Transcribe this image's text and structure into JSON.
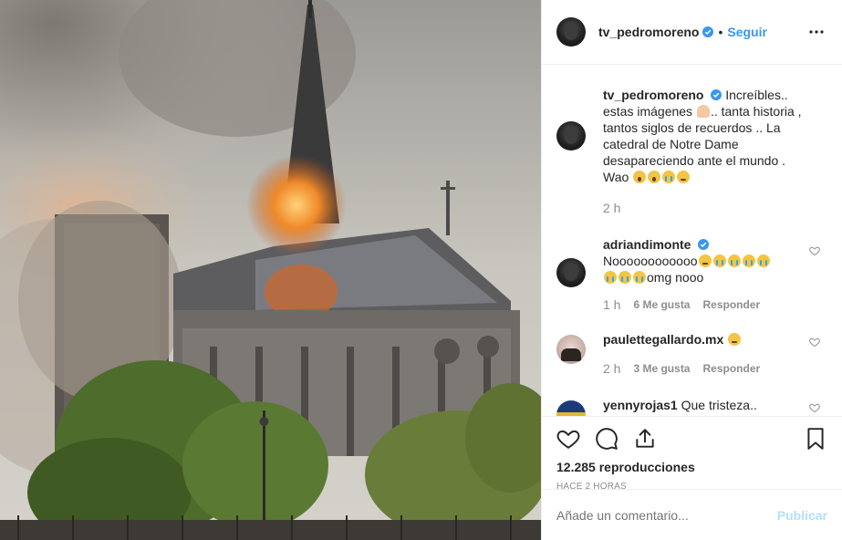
{
  "post": {
    "username": "tv_pedromoreno",
    "follow_label": "Seguir",
    "dot": "•"
  },
  "caption": {
    "username": "tv_pedromoreno",
    "text_1": "Increíbles.. estas imágenes ",
    "text_2": ".. tanta historia , tantos siglos de recuerdos .. La catedral de Notre Dame desapareciendo ante el mundo . Wao ",
    "time": "2 h",
    "emoji_mid": "person-facepalm",
    "emoji_end": [
      "face-screaming",
      "face-screaming",
      "face-crying",
      "face-pensive"
    ]
  },
  "comments": [
    {
      "username": "adriandimonte",
      "verified": true,
      "text_1": "Noooooooooooo",
      "text_2": "omg nooo",
      "emoji_1": [
        "face-pensive",
        "face-crying",
        "face-crying",
        "face-crying",
        "face-crying"
      ],
      "emoji_2": [
        "face-crying",
        "face-crying",
        "face-crying"
      ],
      "time": "1 h",
      "likes": "6 Me gusta",
      "reply": "Responder"
    },
    {
      "username": "paulettegallardo.mx",
      "verified": false,
      "text_1": "",
      "emoji_1": [
        "face-pensive"
      ],
      "time": "2 h",
      "likes": "3 Me gusta",
      "reply": "Responder"
    },
    {
      "username": "yennyrojas1",
      "verified": false,
      "text_1": "Que tristeza..",
      "time": "",
      "likes": "",
      "reply": ""
    }
  ],
  "actions": {
    "views": "12.285 reproducciones",
    "ago": "HACE 2 HORAS"
  },
  "add_comment": {
    "placeholder": "Añade un comentario...",
    "publish": "Publicar"
  },
  "colors": {
    "link_blue": "#3897f0",
    "verified_blue": "#3897f0",
    "publish_disabled": "#b2dffc",
    "muted_text": "#8e8e8e"
  }
}
